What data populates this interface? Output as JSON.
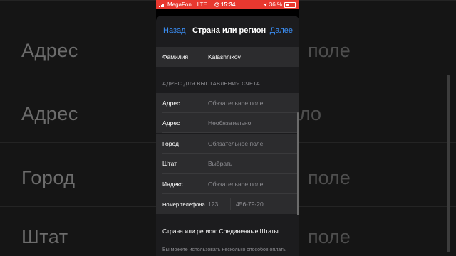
{
  "background": {
    "labels": [
      "Адрес",
      "Адрес",
      "Город",
      "Штат"
    ],
    "ghost": [
      "поле",
      "ло",
      "поле",
      "поле"
    ]
  },
  "status_bar": {
    "carrier": "MegaFon",
    "network": "LTE",
    "time": "15:34",
    "battery": "36 %"
  },
  "nav": {
    "back": "Назад",
    "title": "Страна или регион",
    "done": "Далее"
  },
  "surname": {
    "label": "Фамилия",
    "value": "Kalashnikov"
  },
  "billing": {
    "header": "АДРЕС ДЛЯ ВЫСТАВЛЕНИЯ СЧЕТА",
    "rows": [
      {
        "label": "Адрес",
        "placeholder": "Обязательное поле"
      },
      {
        "label": "Адрес",
        "placeholder": "Необязательно"
      },
      {
        "label": "Город",
        "placeholder": "Обязательное поле"
      },
      {
        "label": "Штат",
        "placeholder": "Выбрать"
      },
      {
        "label": "Индекс",
        "placeholder": "Обязательное поле"
      }
    ],
    "phone": {
      "label": "Номер телефона",
      "code": "123",
      "number": "456-79-20"
    }
  },
  "country": "Страна или регион: Соединенные Штаты",
  "footnote": "Вы можете использовать несколько способов оплаты"
}
